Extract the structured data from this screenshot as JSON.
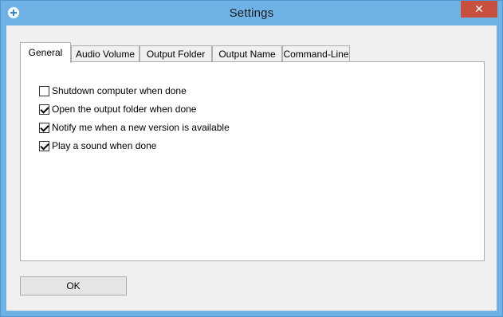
{
  "window": {
    "title": "Settings",
    "close_glyph": "✕",
    "app_icon": "plus-circle-icon"
  },
  "tabs": [
    {
      "label": "General",
      "active": true
    },
    {
      "label": "Audio Volume",
      "active": false
    },
    {
      "label": "Output Folder",
      "active": false
    },
    {
      "label": "Output Name",
      "active": false
    },
    {
      "label": "Command-Line",
      "active": false
    }
  ],
  "general": {
    "options": [
      {
        "label": "Shutdown computer when done",
        "checked": false
      },
      {
        "label": "Open the output folder when done",
        "checked": true
      },
      {
        "label": "Notify me when a new version is available",
        "checked": true
      },
      {
        "label": "Play a sound when done",
        "checked": true
      }
    ]
  },
  "footer": {
    "ok_label": "OK"
  }
}
